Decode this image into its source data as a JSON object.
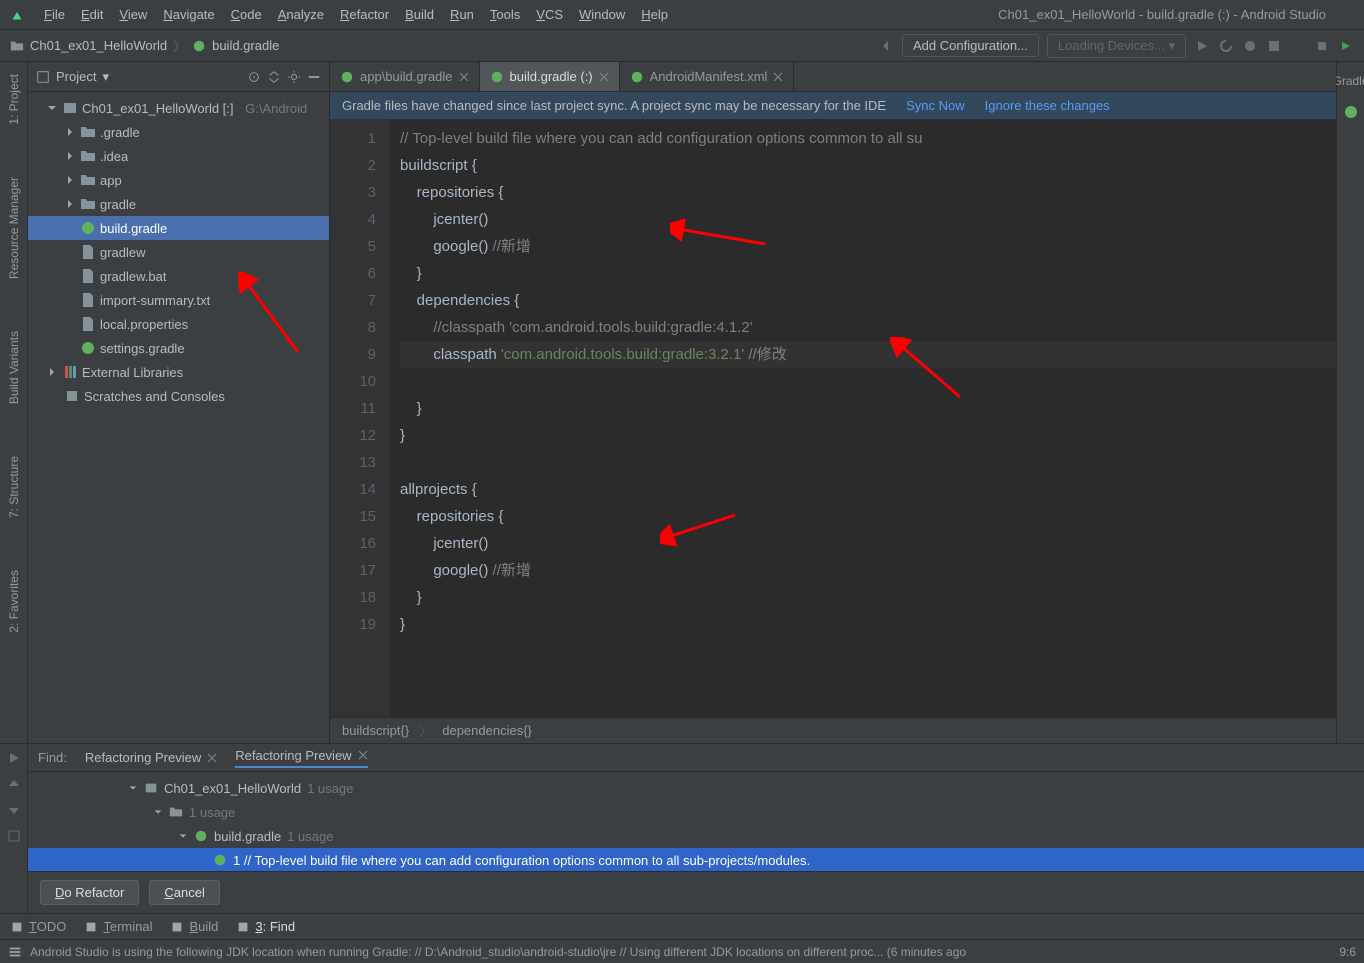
{
  "windowTitle": "Ch01_ex01_HelloWorld - build.gradle (:) - Android Studio",
  "menu": [
    "File",
    "Edit",
    "View",
    "Navigate",
    "Code",
    "Analyze",
    "Refactor",
    "Build",
    "Run",
    "Tools",
    "VCS",
    "Window",
    "Help"
  ],
  "breadcrumb": {
    "root": "Ch01_ex01_HelloWorld",
    "file": "build.gradle"
  },
  "toolbar": {
    "addConfig": "Add Configuration...",
    "devices": "Loading Devices..."
  },
  "leftTools": {
    "project": "1: Project",
    "resmgr": "Resource Manager",
    "variants": "Build Variants",
    "structure": "7: Structure",
    "favorites": "2: Favorites"
  },
  "rightTools": {
    "gradle": "Gradle"
  },
  "projectView": {
    "title": "Project",
    "root": {
      "name": "Ch01_ex01_HelloWorld [:]",
      "path": "G:\\Android"
    },
    "folders": [
      ".gradle",
      ".idea",
      "app",
      "gradle"
    ],
    "files": [
      "build.gradle",
      "gradlew",
      "gradlew.bat",
      "import-summary.txt",
      "local.properties",
      "settings.gradle"
    ],
    "extlib": "External Libraries",
    "scratches": "Scratches and Consoles"
  },
  "editorTabs": [
    {
      "label": "app\\build.gradle",
      "active": false,
      "closable": true
    },
    {
      "label": "build.gradle (:)",
      "active": true,
      "closable": true
    },
    {
      "label": "AndroidManifest.xml",
      "active": false,
      "closable": true
    }
  ],
  "banner": {
    "msg": "Gradle files have changed since last project sync. A project sync may be necessary for the IDE",
    "sync": "Sync Now",
    "ignore": "Ignore these changes"
  },
  "code": {
    "lines": [
      {
        "n": 1,
        "segs": [
          {
            "t": "// Top-level build file where you can add configuration options common to all su",
            "c": "c-comment"
          }
        ]
      },
      {
        "n": 2,
        "segs": [
          {
            "t": "buildscript {",
            "c": ""
          }
        ]
      },
      {
        "n": 3,
        "segs": [
          {
            "t": "    repositories {",
            "c": ""
          }
        ]
      },
      {
        "n": 4,
        "segs": [
          {
            "t": "        jcenter()",
            "c": ""
          }
        ]
      },
      {
        "n": 5,
        "segs": [
          {
            "t": "        google() ",
            "c": ""
          },
          {
            "t": "//新增",
            "c": "c-comment"
          }
        ]
      },
      {
        "n": 6,
        "segs": [
          {
            "t": "    }",
            "c": ""
          }
        ]
      },
      {
        "n": 7,
        "segs": [
          {
            "t": "    dependencies {",
            "c": ""
          }
        ]
      },
      {
        "n": 8,
        "segs": [
          {
            "t": "        ",
            "c": ""
          },
          {
            "t": "//classpath 'com.android.tools.build:gradle:4.1.2'",
            "c": "c-comment"
          }
        ]
      },
      {
        "n": 9,
        "hl": true,
        "segs": [
          {
            "t": "        classpath ",
            "c": ""
          },
          {
            "t": "'com.android.tools.build:gradle:3.2.1'",
            "c": "c-str"
          },
          {
            "t": " ",
            "c": ""
          },
          {
            "t": "//修改",
            "c": "c-comment"
          }
        ]
      },
      {
        "n": 10,
        "segs": [
          {
            "t": "    }",
            "c": ""
          }
        ]
      },
      {
        "n": 11,
        "segs": [
          {
            "t": "}",
            "c": ""
          }
        ]
      },
      {
        "n": 12,
        "segs": [
          {
            "t": "",
            "c": ""
          }
        ]
      },
      {
        "n": 13,
        "segs": [
          {
            "t": "allprojects {",
            "c": ""
          }
        ]
      },
      {
        "n": 14,
        "segs": [
          {
            "t": "    repositories {",
            "c": ""
          }
        ]
      },
      {
        "n": 15,
        "segs": [
          {
            "t": "        jcenter()",
            "c": ""
          }
        ]
      },
      {
        "n": 16,
        "segs": [
          {
            "t": "        google() ",
            "c": ""
          },
          {
            "t": "//新增",
            "c": "c-comment"
          }
        ]
      },
      {
        "n": 17,
        "segs": [
          {
            "t": "    }",
            "c": ""
          }
        ]
      },
      {
        "n": 18,
        "segs": [
          {
            "t": "}",
            "c": ""
          }
        ]
      },
      {
        "n": 19,
        "segs": [
          {
            "t": "",
            "c": ""
          }
        ]
      }
    ],
    "crumbs": [
      "buildscript{}",
      "dependencies{}"
    ]
  },
  "find": {
    "label": "Find:",
    "tabs": [
      {
        "label": "Refactoring Preview",
        "active": false
      },
      {
        "label": "Refactoring Preview",
        "active": true
      }
    ],
    "tree": {
      "root": "Ch01_ex01_HelloWorld",
      "rootUsage": "1 usage",
      "dir": "",
      "dirUsage": "1 usage",
      "file": "build.gradle",
      "fileUsage": "1 usage",
      "match": "1 // Top-level build file where you can add configuration options common to all sub-projects/modules."
    },
    "doRefactor": "Do Refactor",
    "cancel": "Cancel"
  },
  "bottomTabs": [
    {
      "label": "TODO",
      "icon": "list"
    },
    {
      "label": "Terminal",
      "icon": "terminal"
    },
    {
      "label": "Build",
      "icon": "hammer"
    },
    {
      "label": "3: Find",
      "icon": "search",
      "active": true
    }
  ],
  "status": {
    "msg": "Android Studio is using the following JDK location when running Gradle: // D:\\Android_studio\\android-studio\\jre // Using different JDK locations on different proc... (6 minutes ago",
    "pos": "9:6"
  }
}
